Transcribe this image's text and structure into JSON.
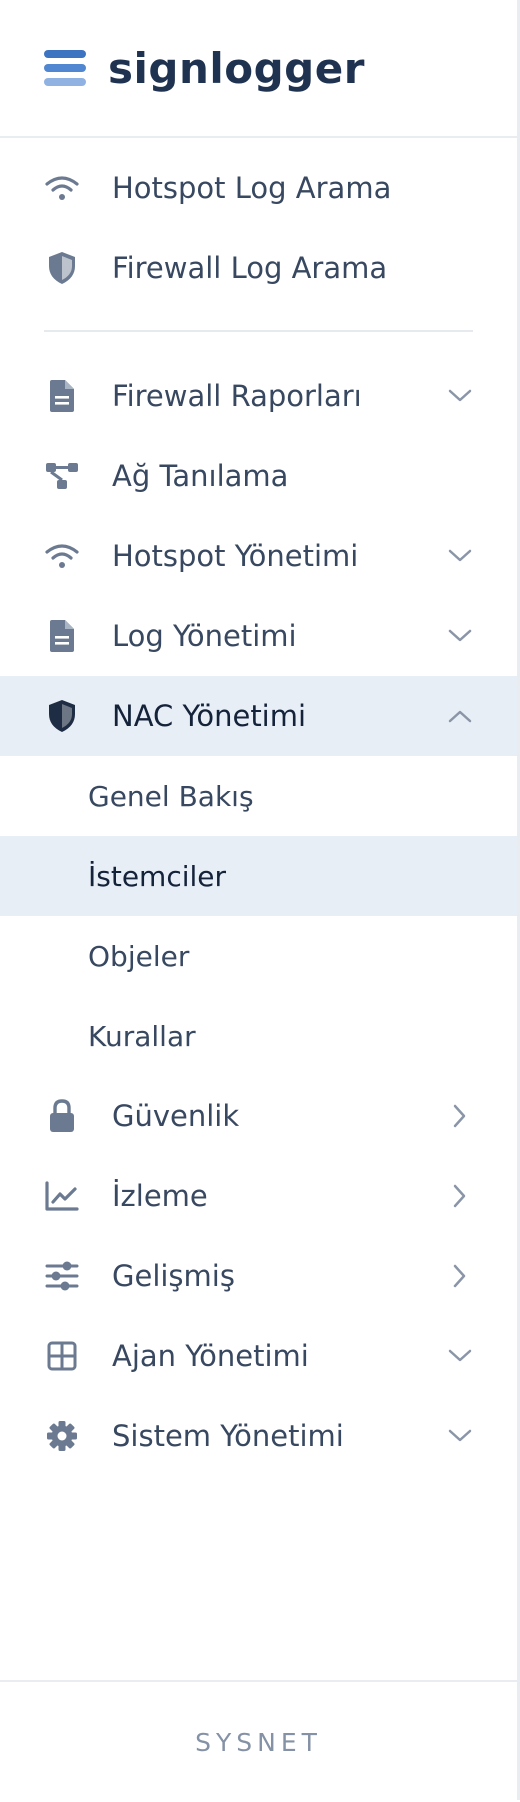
{
  "brand": {
    "name": "signlogger",
    "colors": {
      "bar_top": "#3d74c2",
      "bar_mid": "#5187d0",
      "bar_bottom": "#8fb2e3",
      "text": "#1f3250"
    }
  },
  "nav": {
    "top_items": [
      {
        "label": "Hotspot Log Arama",
        "icon": "wifi-icon"
      },
      {
        "label": "Firewall Log Arama",
        "icon": "shield-icon"
      }
    ],
    "items": [
      {
        "label": "Firewall Raporları",
        "icon": "document-icon",
        "chevron": "down"
      },
      {
        "label": "Ağ Tanılama",
        "icon": "network-icon",
        "chevron": ""
      },
      {
        "label": "Hotspot Yönetimi",
        "icon": "wifi-icon",
        "chevron": "down"
      },
      {
        "label": "Log Yönetimi",
        "icon": "document-icon",
        "chevron": "down"
      },
      {
        "label": "NAC Yönetimi",
        "icon": "shield-icon",
        "chevron": "up",
        "active": true
      }
    ],
    "nac_subitems": [
      {
        "label": "Genel Bakış"
      },
      {
        "label": "İstemciler",
        "active": true
      },
      {
        "label": "Objeler"
      },
      {
        "label": "Kurallar"
      }
    ],
    "bottom_items": [
      {
        "label": "Güvenlik",
        "icon": "lock-icon",
        "chevron": "right"
      },
      {
        "label": "İzleme",
        "icon": "chart-line-icon",
        "chevron": "right"
      },
      {
        "label": "Gelişmiş",
        "icon": "sliders-icon",
        "chevron": "right"
      },
      {
        "label": "Ajan Yönetimi",
        "icon": "grid-icon",
        "chevron": "down"
      },
      {
        "label": "Sistem Yönetimi",
        "icon": "gear-icon",
        "chevron": "down"
      }
    ]
  },
  "footer": {
    "text": "SYSNET"
  },
  "colors": {
    "active_bg": "#e7eef6",
    "icon_gray": "#6b7a90",
    "icon_dark": "#1f2d44",
    "text": "#384860"
  }
}
